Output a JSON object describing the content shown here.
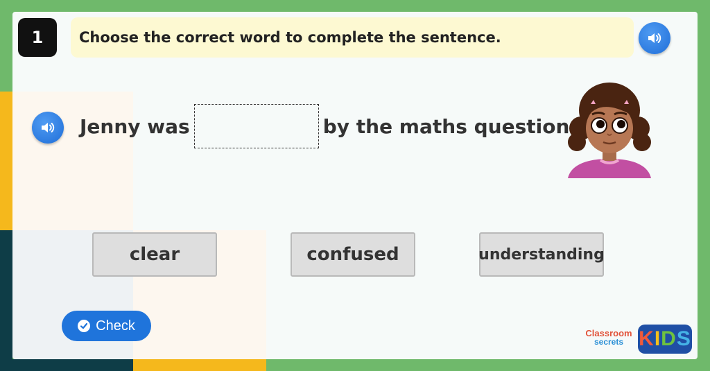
{
  "question": {
    "number": "1",
    "instruction": "Choose the correct word to complete the sentence.",
    "sentence_before": "Jenny was",
    "sentence_after": "by the maths question."
  },
  "options": [
    {
      "label": "clear"
    },
    {
      "label": "confused"
    },
    {
      "label": "understanding"
    }
  ],
  "check_button": {
    "label": "Check"
  },
  "branding": {
    "logo_line1": "Classroom",
    "logo_line2": "secrets",
    "kids_letters": [
      "K",
      "I",
      "D",
      "S"
    ]
  },
  "colors": {
    "background": "#6fb96b",
    "accent_blue": "#1f74db",
    "instruction_bg": "#fdf9d2",
    "option_bg": "#dedede"
  },
  "icons": [
    "speaker-icon",
    "check-circle-icon"
  ]
}
